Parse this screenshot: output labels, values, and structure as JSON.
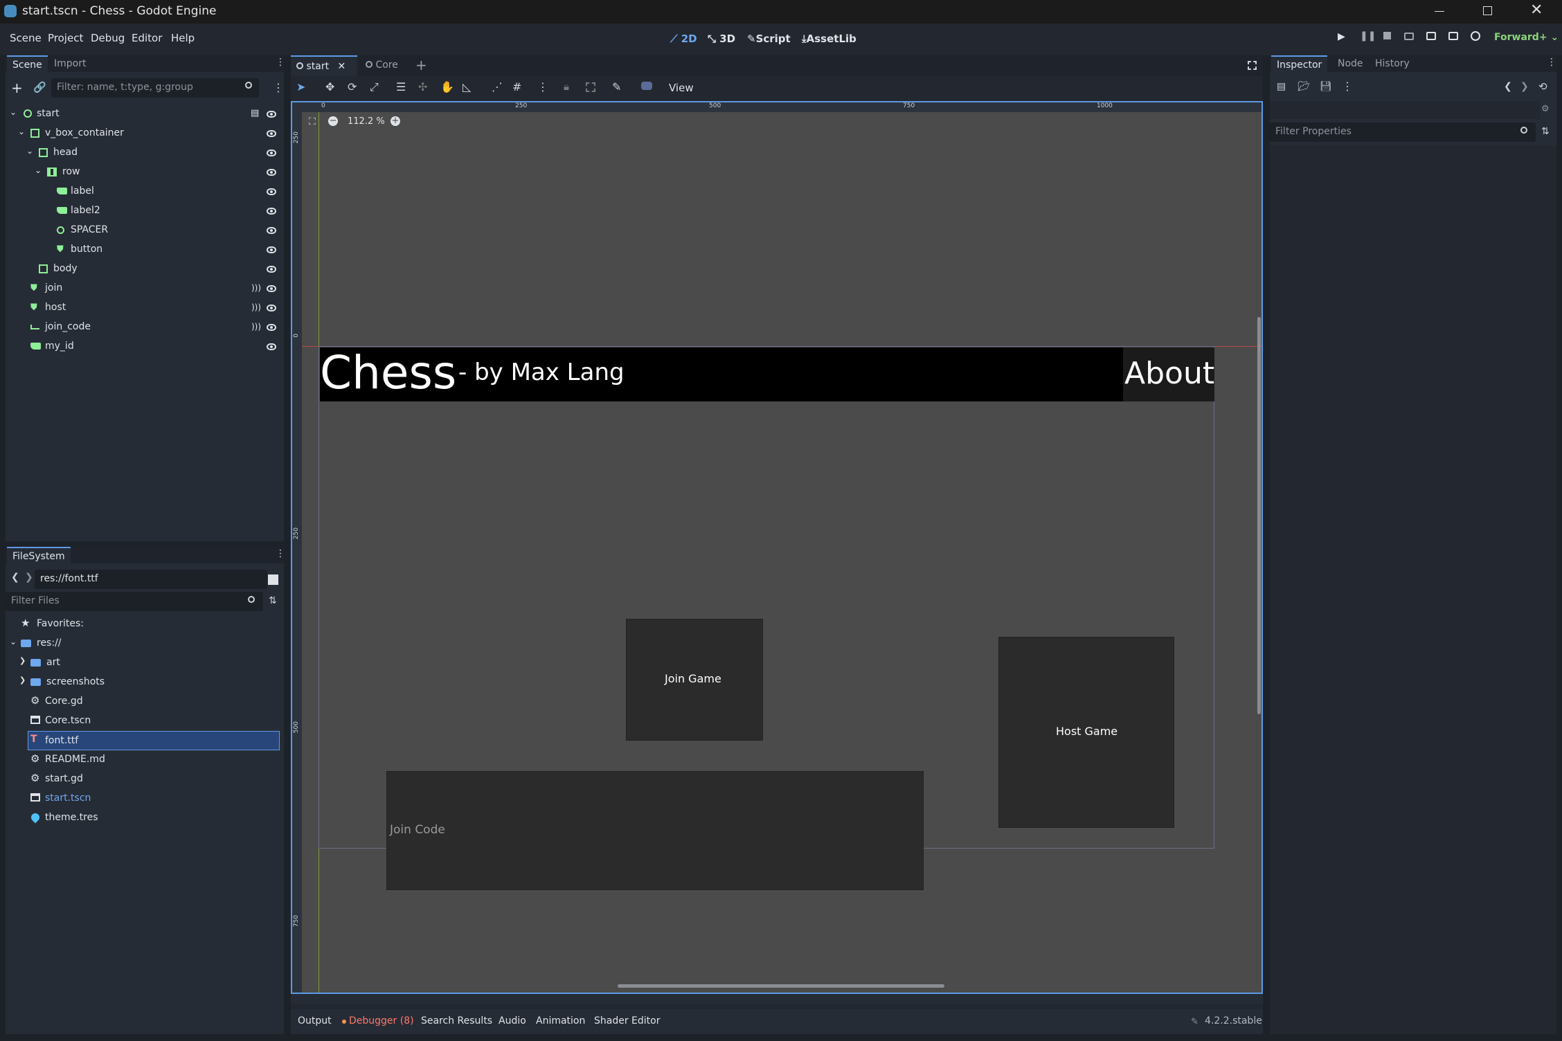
{
  "window": {
    "title": "start.tscn - Chess - Godot Engine"
  },
  "menu": [
    "Scene",
    "Project",
    "Debug",
    "Editor",
    "Help"
  ],
  "workspaces": [
    "2D",
    "3D",
    "Script",
    "AssetLib"
  ],
  "renderer": "Forward+",
  "scene_dock": {
    "tabs": [
      "Scene",
      "Import"
    ],
    "filter_placeholder": "Filter: name, t:type, g:group",
    "nodes": [
      "start",
      "v_box_container",
      "head",
      "row",
      "label",
      "label2",
      "SPACER",
      "button",
      "body",
      "join",
      "host",
      "join_code",
      "my_id"
    ]
  },
  "filesystem": {
    "tab": "FileSystem",
    "path": "res://font.ttf",
    "filter_placeholder": "Filter Files",
    "items": [
      "Favorites:",
      "res://",
      "art",
      "screenshots",
      "Core.gd",
      "Core.tscn",
      "font.ttf",
      "README.md",
      "start.gd",
      "start.tscn",
      "theme.tres"
    ]
  },
  "editor_tabs": [
    "start",
    "Core"
  ],
  "toolbar": {
    "view": "View"
  },
  "viewport": {
    "zoom": "112.2 %",
    "ruler_top": [
      "0",
      "250",
      "500",
      "750",
      "1000"
    ],
    "ruler_left": [
      "250",
      "0",
      "250",
      "500",
      "750"
    ],
    "title_big": "Chess",
    "title_small": "- by Max Lang",
    "about": "About",
    "join_game": "Join Game",
    "host_game": "Host Game",
    "join_code_placeholder": "Join Code"
  },
  "inspector": {
    "tabs": [
      "Inspector",
      "Node",
      "History"
    ],
    "filter_placeholder": "Filter Properties"
  },
  "bottom_panel": {
    "tabs": [
      "Output",
      "Debugger (8)",
      "Search Results",
      "Audio",
      "Animation",
      "Shader Editor"
    ],
    "version": "4.2.2.stable"
  },
  "colors": {
    "accent": "#5c9ae6",
    "node_green": "#8eef97",
    "error": "#ff786b",
    "selected": "#28467a"
  }
}
